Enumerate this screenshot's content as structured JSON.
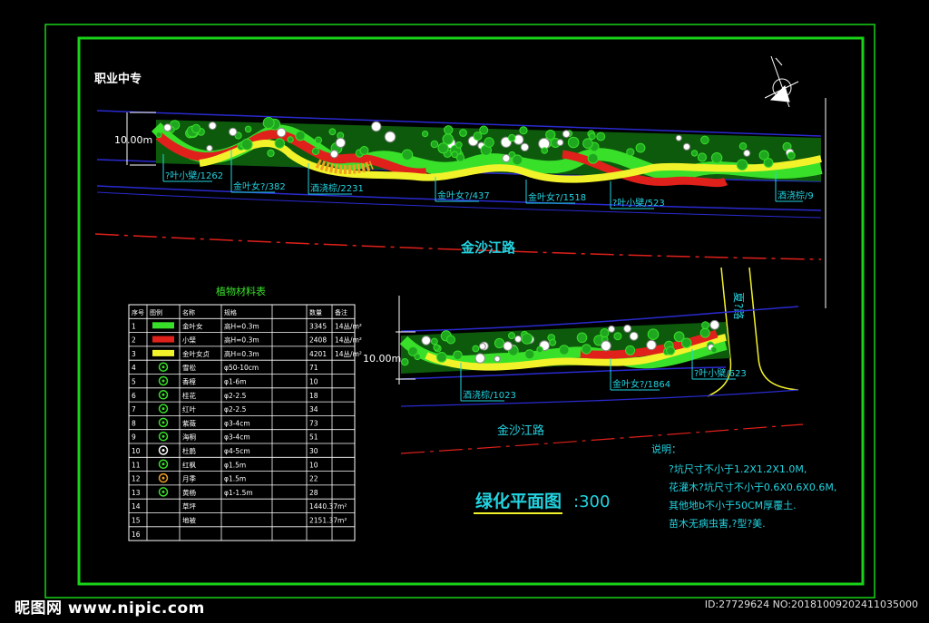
{
  "title_block": "职业中专",
  "road_main": "金沙江路",
  "road_lower": "金沙江路",
  "side_road": "夏?路",
  "dim_label": "10.00m",
  "drawing_title": "绿化平面图",
  "scale": ":300",
  "upper_labels": [
    "?叶小檗/1262",
    "金叶女?/382",
    "酒浇棕/2231",
    "金叶女?/437",
    "金叶女?/1518",
    "?叶小檗/523",
    "酒浇棕/9"
  ],
  "lower_labels": [
    "酒浇棕/1023",
    "金叶女?/1864",
    "?叶小檗/623"
  ],
  "legend": {
    "title": "植物材料表",
    "headers": [
      "序号",
      "图例",
      "名称",
      "规格",
      "",
      "数量",
      "备注"
    ],
    "rows": [
      {
        "n": "1",
        "sym": "hatch-green",
        "name": "金叶女",
        "spec": "高H=0.3m",
        "qty": "3345",
        "note": "14丛/m²"
      },
      {
        "n": "2",
        "sym": "hatch-red",
        "name": "小檗",
        "spec": "高H=0.3m",
        "qty": "2408",
        "note": "14丛/m²"
      },
      {
        "n": "3",
        "sym": "hatch-yellow",
        "name": "金叶女贞",
        "spec": "高H=0.3m",
        "qty": "4201",
        "note": "14丛/m²"
      },
      {
        "n": "4",
        "sym": "tree-a",
        "name": "雪松",
        "spec": "φ50-10cm",
        "qty": "71",
        "note": ""
      },
      {
        "n": "5",
        "sym": "tree-b",
        "name": "香樟",
        "spec": "φ1-6m",
        "qty": "10",
        "note": ""
      },
      {
        "n": "6",
        "sym": "tree-c",
        "name": "桂花",
        "spec": "φ2-2.5",
        "qty": "18",
        "note": ""
      },
      {
        "n": "7",
        "sym": "tree-d",
        "name": "红叶",
        "spec": "φ2-2.5",
        "qty": "34",
        "note": ""
      },
      {
        "n": "8",
        "sym": "tree-e",
        "name": "紫薇",
        "spec": "φ3-4cm",
        "qty": "73",
        "note": ""
      },
      {
        "n": "9",
        "sym": "tree-f",
        "name": "海桐",
        "spec": "φ3-4cm",
        "qty": "51",
        "note": ""
      },
      {
        "n": "10",
        "sym": "tree-g",
        "name": "杜鹃",
        "spec": "φ4-5cm",
        "qty": "30",
        "note": ""
      },
      {
        "n": "11",
        "sym": "tree-h",
        "name": "红枫",
        "spec": "φ1.5m",
        "qty": "10",
        "note": ""
      },
      {
        "n": "12",
        "sym": "tree-i",
        "name": "月季",
        "spec": "φ1.5m",
        "qty": "22",
        "note": ""
      },
      {
        "n": "13",
        "sym": "tree-j",
        "name": "黄杨",
        "spec": "φ1-1.5m",
        "qty": "28",
        "note": ""
      },
      {
        "n": "14",
        "sym": "",
        "name": "草坪",
        "spec": "",
        "qty": "1440.37m²",
        "note": ""
      },
      {
        "n": "15",
        "sym": "",
        "name": "地被",
        "spec": "",
        "qty": "2151.37m²",
        "note": ""
      },
      {
        "n": "16",
        "sym": "",
        "name": "",
        "spec": "",
        "qty": "",
        "note": ""
      }
    ]
  },
  "notes": {
    "heading": "说明：",
    "lines": [
      "?坑尺寸不小于1.2X1.2X1.0M,",
      "花灌木?坑尺寸不小于0.6X0.6X0.6M,",
      "其他地b不小于50CM厚覆土.",
      "苗木无病虫害,?型?美."
    ]
  },
  "watermark": "昵图网 www.nipic.com",
  "image_id": "ID:27729624 NO:20181009202411035000",
  "colors": {
    "frame": "#19d219",
    "blue": "#2a2ad0",
    "cyan": "#22d3e0",
    "green": "#39e02a",
    "red": "#e0201a",
    "yellow": "#f2f22a",
    "orange": "#f0a020"
  }
}
